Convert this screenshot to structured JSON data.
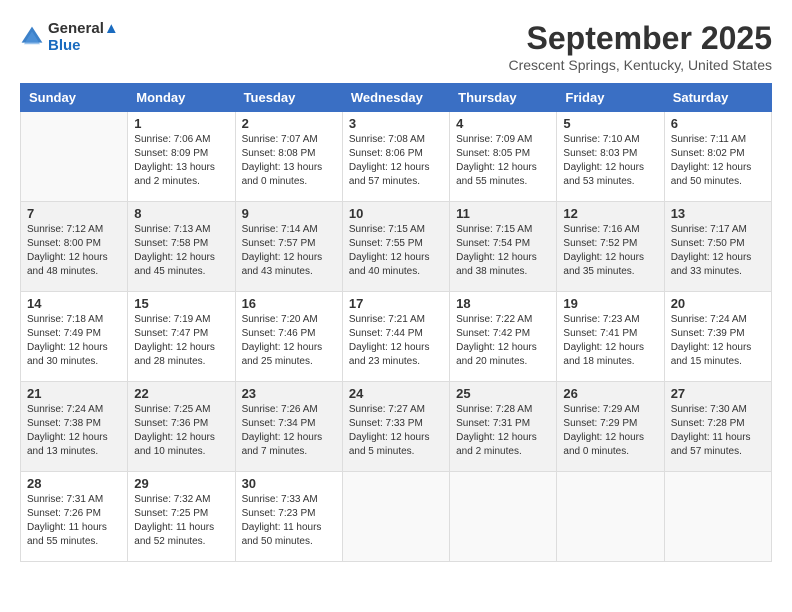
{
  "header": {
    "logo_line1": "General",
    "logo_line2": "Blue",
    "month_title": "September 2025",
    "location": "Crescent Springs, Kentucky, United States"
  },
  "days_of_week": [
    "Sunday",
    "Monday",
    "Tuesday",
    "Wednesday",
    "Thursday",
    "Friday",
    "Saturday"
  ],
  "weeks": [
    [
      {
        "num": "",
        "info": ""
      },
      {
        "num": "1",
        "info": "Sunrise: 7:06 AM\nSunset: 8:09 PM\nDaylight: 13 hours\nand 2 minutes."
      },
      {
        "num": "2",
        "info": "Sunrise: 7:07 AM\nSunset: 8:08 PM\nDaylight: 13 hours\nand 0 minutes."
      },
      {
        "num": "3",
        "info": "Sunrise: 7:08 AM\nSunset: 8:06 PM\nDaylight: 12 hours\nand 57 minutes."
      },
      {
        "num": "4",
        "info": "Sunrise: 7:09 AM\nSunset: 8:05 PM\nDaylight: 12 hours\nand 55 minutes."
      },
      {
        "num": "5",
        "info": "Sunrise: 7:10 AM\nSunset: 8:03 PM\nDaylight: 12 hours\nand 53 minutes."
      },
      {
        "num": "6",
        "info": "Sunrise: 7:11 AM\nSunset: 8:02 PM\nDaylight: 12 hours\nand 50 minutes."
      }
    ],
    [
      {
        "num": "7",
        "info": "Sunrise: 7:12 AM\nSunset: 8:00 PM\nDaylight: 12 hours\nand 48 minutes."
      },
      {
        "num": "8",
        "info": "Sunrise: 7:13 AM\nSunset: 7:58 PM\nDaylight: 12 hours\nand 45 minutes."
      },
      {
        "num": "9",
        "info": "Sunrise: 7:14 AM\nSunset: 7:57 PM\nDaylight: 12 hours\nand 43 minutes."
      },
      {
        "num": "10",
        "info": "Sunrise: 7:15 AM\nSunset: 7:55 PM\nDaylight: 12 hours\nand 40 minutes."
      },
      {
        "num": "11",
        "info": "Sunrise: 7:15 AM\nSunset: 7:54 PM\nDaylight: 12 hours\nand 38 minutes."
      },
      {
        "num": "12",
        "info": "Sunrise: 7:16 AM\nSunset: 7:52 PM\nDaylight: 12 hours\nand 35 minutes."
      },
      {
        "num": "13",
        "info": "Sunrise: 7:17 AM\nSunset: 7:50 PM\nDaylight: 12 hours\nand 33 minutes."
      }
    ],
    [
      {
        "num": "14",
        "info": "Sunrise: 7:18 AM\nSunset: 7:49 PM\nDaylight: 12 hours\nand 30 minutes."
      },
      {
        "num": "15",
        "info": "Sunrise: 7:19 AM\nSunset: 7:47 PM\nDaylight: 12 hours\nand 28 minutes."
      },
      {
        "num": "16",
        "info": "Sunrise: 7:20 AM\nSunset: 7:46 PM\nDaylight: 12 hours\nand 25 minutes."
      },
      {
        "num": "17",
        "info": "Sunrise: 7:21 AM\nSunset: 7:44 PM\nDaylight: 12 hours\nand 23 minutes."
      },
      {
        "num": "18",
        "info": "Sunrise: 7:22 AM\nSunset: 7:42 PM\nDaylight: 12 hours\nand 20 minutes."
      },
      {
        "num": "19",
        "info": "Sunrise: 7:23 AM\nSunset: 7:41 PM\nDaylight: 12 hours\nand 18 minutes."
      },
      {
        "num": "20",
        "info": "Sunrise: 7:24 AM\nSunset: 7:39 PM\nDaylight: 12 hours\nand 15 minutes."
      }
    ],
    [
      {
        "num": "21",
        "info": "Sunrise: 7:24 AM\nSunset: 7:38 PM\nDaylight: 12 hours\nand 13 minutes."
      },
      {
        "num": "22",
        "info": "Sunrise: 7:25 AM\nSunset: 7:36 PM\nDaylight: 12 hours\nand 10 minutes."
      },
      {
        "num": "23",
        "info": "Sunrise: 7:26 AM\nSunset: 7:34 PM\nDaylight: 12 hours\nand 7 minutes."
      },
      {
        "num": "24",
        "info": "Sunrise: 7:27 AM\nSunset: 7:33 PM\nDaylight: 12 hours\nand 5 minutes."
      },
      {
        "num": "25",
        "info": "Sunrise: 7:28 AM\nSunset: 7:31 PM\nDaylight: 12 hours\nand 2 minutes."
      },
      {
        "num": "26",
        "info": "Sunrise: 7:29 AM\nSunset: 7:29 PM\nDaylight: 12 hours\nand 0 minutes."
      },
      {
        "num": "27",
        "info": "Sunrise: 7:30 AM\nSunset: 7:28 PM\nDaylight: 11 hours\nand 57 minutes."
      }
    ],
    [
      {
        "num": "28",
        "info": "Sunrise: 7:31 AM\nSunset: 7:26 PM\nDaylight: 11 hours\nand 55 minutes."
      },
      {
        "num": "29",
        "info": "Sunrise: 7:32 AM\nSunset: 7:25 PM\nDaylight: 11 hours\nand 52 minutes."
      },
      {
        "num": "30",
        "info": "Sunrise: 7:33 AM\nSunset: 7:23 PM\nDaylight: 11 hours\nand 50 minutes."
      },
      {
        "num": "",
        "info": ""
      },
      {
        "num": "",
        "info": ""
      },
      {
        "num": "",
        "info": ""
      },
      {
        "num": "",
        "info": ""
      }
    ]
  ]
}
